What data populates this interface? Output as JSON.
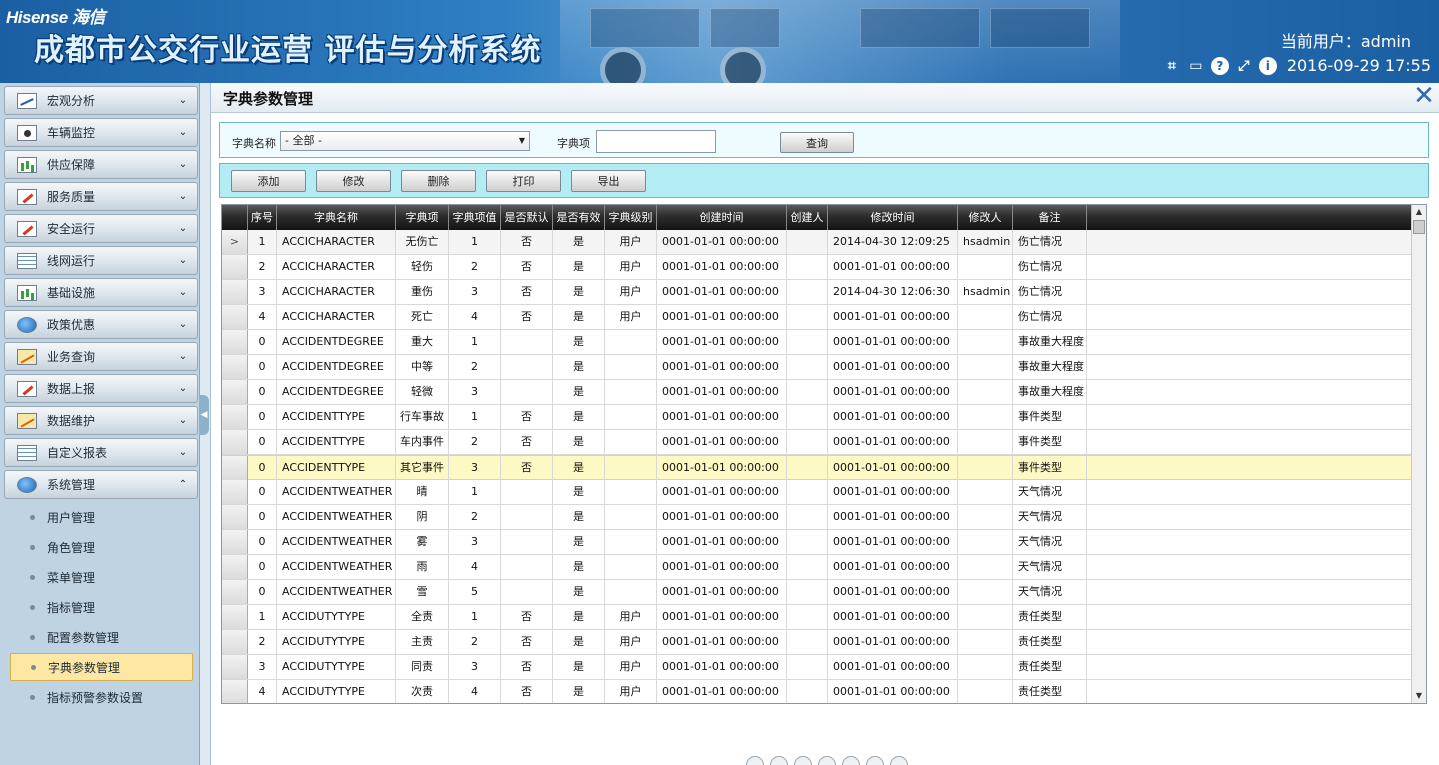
{
  "header": {
    "brand": "Hisense 海信",
    "title": "成都市公交行业运营 评估与分析系统",
    "current_user": "当前用户：admin",
    "datetime": "2016-09-29 17:55"
  },
  "sidebar": {
    "menus": [
      {
        "label": "宏观分析",
        "icon": "chart",
        "expanded": false
      },
      {
        "label": "车辆监控",
        "icon": "camera",
        "expanded": false
      },
      {
        "label": "供应保障",
        "icon": "bars",
        "expanded": false
      },
      {
        "label": "服务质量",
        "icon": "pen",
        "expanded": false
      },
      {
        "label": "安全运行",
        "icon": "pen",
        "expanded": false
      },
      {
        "label": "线网运行",
        "icon": "grid",
        "expanded": false
      },
      {
        "label": "基础设施",
        "icon": "bars",
        "expanded": false
      },
      {
        "label": "政策优惠",
        "icon": "globe",
        "expanded": false
      },
      {
        "label": "业务查询",
        "icon": "trend",
        "expanded": false
      },
      {
        "label": "数据上报",
        "icon": "pen",
        "expanded": false
      },
      {
        "label": "数据维护",
        "icon": "trend",
        "expanded": false
      },
      {
        "label": "自定义报表",
        "icon": "grid",
        "expanded": false
      },
      {
        "label": "系统管理",
        "icon": "globe",
        "expanded": true
      }
    ],
    "sub_items": [
      {
        "label": "用户管理",
        "active": false
      },
      {
        "label": "角色管理",
        "active": false
      },
      {
        "label": "菜单管理",
        "active": false
      },
      {
        "label": "指标管理",
        "active": false
      },
      {
        "label": "配置参数管理",
        "active": false
      },
      {
        "label": "字典参数管理",
        "active": true
      },
      {
        "label": "指标预警参数设置",
        "active": false
      }
    ]
  },
  "panel": {
    "title": "字典参数管理",
    "close_label": "✕"
  },
  "filter": {
    "dict_name_label": "字典名称",
    "dict_name_value": "- 全部 -",
    "dict_item_label": "字典项",
    "dict_item_value": "",
    "query_label": "查询"
  },
  "actions": {
    "add": "添加",
    "edit": "修改",
    "delete": "删除",
    "print": "打印",
    "export": "导出"
  },
  "grid": {
    "columns": [
      "序号",
      "字典名称",
      "字典项",
      "字典项值",
      "是否默认",
      "是否有效",
      "字典级别",
      "创建时间",
      "创建人",
      "修改时间",
      "修改人",
      "备注"
    ],
    "rows": [
      [
        "1",
        "ACCICHARACTER",
        "无伤亡",
        "1",
        "否",
        "是",
        "用户",
        "0001-01-01 00:00:00",
        "",
        "2014-04-30 12:09:25",
        "hsadmin",
        "伤亡情况"
      ],
      [
        "2",
        "ACCICHARACTER",
        "轻伤",
        "2",
        "否",
        "是",
        "用户",
        "0001-01-01 00:00:00",
        "",
        "0001-01-01 00:00:00",
        "",
        "伤亡情况"
      ],
      [
        "3",
        "ACCICHARACTER",
        "重伤",
        "3",
        "否",
        "是",
        "用户",
        "0001-01-01 00:00:00",
        "",
        "2014-04-30 12:06:30",
        "hsadmin",
        "伤亡情况"
      ],
      [
        "4",
        "ACCICHARACTER",
        "死亡",
        "4",
        "否",
        "是",
        "用户",
        "0001-01-01 00:00:00",
        "",
        "0001-01-01 00:00:00",
        "",
        "伤亡情况"
      ],
      [
        "0",
        "ACCIDENTDEGREE",
        "重大",
        "1",
        "",
        "是",
        "",
        "0001-01-01 00:00:00",
        "",
        "0001-01-01 00:00:00",
        "",
        "事故重大程度"
      ],
      [
        "0",
        "ACCIDENTDEGREE",
        "中等",
        "2",
        "",
        "是",
        "",
        "0001-01-01 00:00:00",
        "",
        "0001-01-01 00:00:00",
        "",
        "事故重大程度"
      ],
      [
        "0",
        "ACCIDENTDEGREE",
        "轻微",
        "3",
        "",
        "是",
        "",
        "0001-01-01 00:00:00",
        "",
        "0001-01-01 00:00:00",
        "",
        "事故重大程度"
      ],
      [
        "0",
        "ACCIDENTTYPE",
        "行车事故",
        "1",
        "否",
        "是",
        "",
        "0001-01-01 00:00:00",
        "",
        "0001-01-01 00:00:00",
        "",
        "事件类型"
      ],
      [
        "0",
        "ACCIDENTTYPE",
        "车内事件",
        "2",
        "否",
        "是",
        "",
        "0001-01-01 00:00:00",
        "",
        "0001-01-01 00:00:00",
        "",
        "事件类型"
      ],
      [
        "0",
        "ACCIDENTTYPE",
        "其它事件",
        "3",
        "否",
        "是",
        "",
        "0001-01-01 00:00:00",
        "",
        "0001-01-01 00:00:00",
        "",
        "事件类型"
      ],
      [
        "0",
        "ACCIDENTWEATHER",
        "晴",
        "1",
        "",
        "是",
        "",
        "0001-01-01 00:00:00",
        "",
        "0001-01-01 00:00:00",
        "",
        "天气情况"
      ],
      [
        "0",
        "ACCIDENTWEATHER",
        "阴",
        "2",
        "",
        "是",
        "",
        "0001-01-01 00:00:00",
        "",
        "0001-01-01 00:00:00",
        "",
        "天气情况"
      ],
      [
        "0",
        "ACCIDENTWEATHER",
        "雾",
        "3",
        "",
        "是",
        "",
        "0001-01-01 00:00:00",
        "",
        "0001-01-01 00:00:00",
        "",
        "天气情况"
      ],
      [
        "0",
        "ACCIDENTWEATHER",
        "雨",
        "4",
        "",
        "是",
        "",
        "0001-01-01 00:00:00",
        "",
        "0001-01-01 00:00:00",
        "",
        "天气情况"
      ],
      [
        "0",
        "ACCIDENTWEATHER",
        "雪",
        "5",
        "",
        "是",
        "",
        "0001-01-01 00:00:00",
        "",
        "0001-01-01 00:00:00",
        "",
        "天气情况"
      ],
      [
        "1",
        "ACCIDUTYTYPE",
        "全责",
        "1",
        "否",
        "是",
        "用户",
        "0001-01-01 00:00:00",
        "",
        "0001-01-01 00:00:00",
        "",
        "责任类型"
      ],
      [
        "2",
        "ACCIDUTYTYPE",
        "主责",
        "2",
        "否",
        "是",
        "用户",
        "0001-01-01 00:00:00",
        "",
        "0001-01-01 00:00:00",
        "",
        "责任类型"
      ],
      [
        "3",
        "ACCIDUTYTYPE",
        "同责",
        "3",
        "否",
        "是",
        "用户",
        "0001-01-01 00:00:00",
        "",
        "0001-01-01 00:00:00",
        "",
        "责任类型"
      ],
      [
        "4",
        "ACCIDUTYTYPE",
        "次责",
        "4",
        "否",
        "是",
        "用户",
        "0001-01-01 00:00:00",
        "",
        "0001-01-01 00:00:00",
        "",
        "责任类型"
      ]
    ],
    "selected_row_marker": ">",
    "highlighted_row": 9
  },
  "colors": {
    "header_blue": "#1b5fa3",
    "filter_bg": "#eefcff",
    "action_bg": "#b4ecf3",
    "active_sub_bg": "#fde7a5",
    "highlight_row": "#fdf9c4"
  }
}
